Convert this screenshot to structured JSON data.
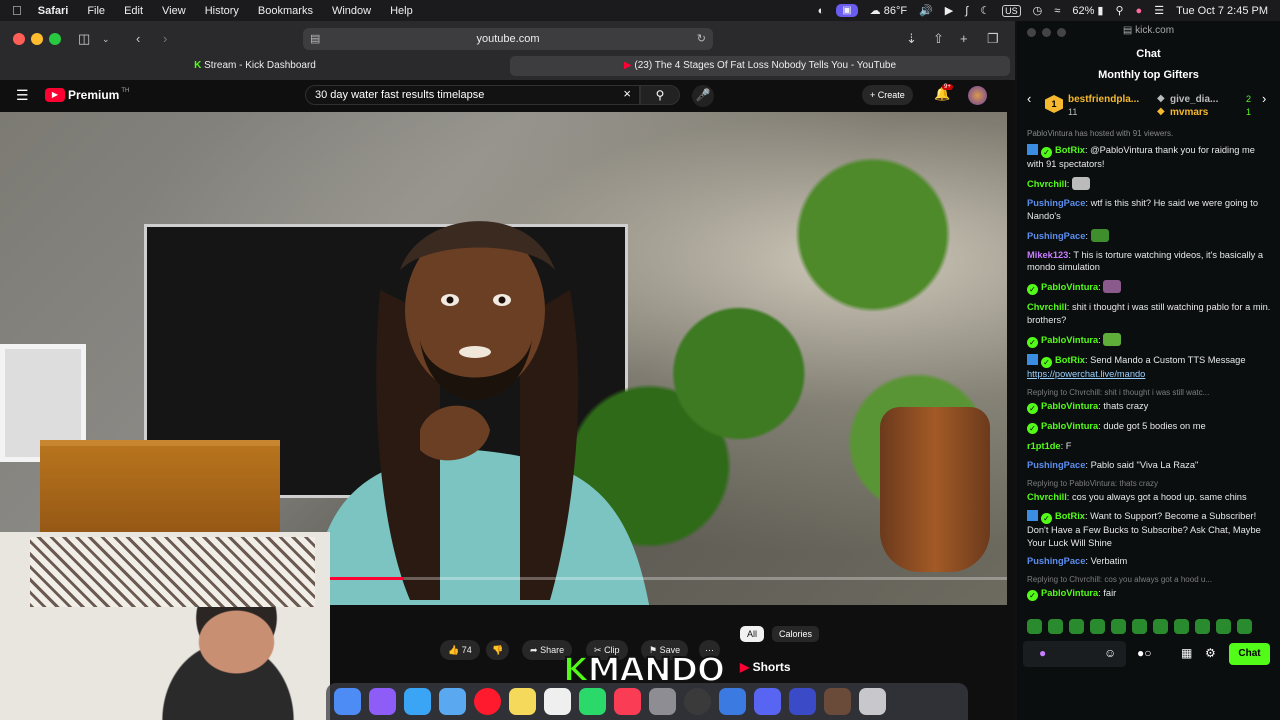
{
  "menubar": {
    "apple": "",
    "app": "Safari",
    "items": [
      "File",
      "Edit",
      "View",
      "History",
      "Bookmarks",
      "Window",
      "Help"
    ],
    "weather": "86°F",
    "flag": "US",
    "battery": "62%",
    "datetime": "Tue Oct 7  2:45 PM"
  },
  "safari": {
    "url": "youtube.com",
    "tabs": [
      {
        "label": "Stream - Kick Dashboard"
      },
      {
        "label": "(23) The 4 Stages Of Fat Loss Nobody Tells You - YouTube"
      }
    ]
  },
  "youtube": {
    "logo": "Premium",
    "logo_sup": "TH",
    "search_value": "30 day water fast results timelapse",
    "create_label": "Create",
    "notif_count": "9+",
    "progress": 0.11,
    "likes": "74",
    "share_label": "Share",
    "clip_label": "Clip",
    "save_label": "Save",
    "chips": [
      "All",
      "Calories"
    ],
    "shorts_label": "Shorts"
  },
  "overlay": {
    "k": "K",
    "text": "MANDO"
  },
  "kick": {
    "url": "kick.com",
    "chat_title": "Chat",
    "gifters_title": "Monthly top Gifters",
    "gifters": [
      {
        "rank": "1",
        "name": "bestfriendpla...",
        "count": "11"
      },
      {
        "rank": "",
        "name": "give_dia...",
        "count": "2"
      },
      {
        "rank": "",
        "name": "mvmars",
        "count": "1"
      }
    ],
    "host_notice": "PabloVintura has hosted with 91 viewers.",
    "messages": [
      {
        "user": "BotRix",
        "color": "#53fc18",
        "bot": true,
        "text": "@PabloVintura thank you for raiding me with 91 spectators!"
      },
      {
        "user": "Chvrchill",
        "color": "#53fc18",
        "text": "",
        "emote": "#bbbbbb"
      },
      {
        "user": "PushingPace",
        "color": "#5b8ef0",
        "text": "wtf is this shit? He said we were going to Nando's"
      },
      {
        "user": "PushingPace",
        "color": "#5b8ef0",
        "text": "",
        "emote": "#3e8e2e"
      },
      {
        "user": "Mikek123",
        "color": "#c77dff",
        "text": "T his is torture watching videos, it's basically a mondo simulation"
      },
      {
        "user": "PabloVintura",
        "color": "#53fc18",
        "verified": true,
        "text": "",
        "emote": "#8b5a8c"
      },
      {
        "user": "Chvrchill",
        "color": "#53fc18",
        "text": "shit i thought i was still watching pablo for a min. brothers?"
      },
      {
        "user": "PabloVintura",
        "color": "#53fc18",
        "verified": true,
        "text": "",
        "emote": "#5fae3a"
      },
      {
        "user": "BotRix",
        "color": "#53fc18",
        "bot": true,
        "text": "Send Mando a Custom TTS Message",
        "link": "https://powerchat.live/mando"
      },
      {
        "reply": "Replying to Chvrchill: shit i thought i was still watc...",
        "user": "PabloVintura",
        "color": "#53fc18",
        "verified": true,
        "text": "thats crazy"
      },
      {
        "user": "PabloVintura",
        "color": "#53fc18",
        "verified": true,
        "text": "dude got 5 bodies on me"
      },
      {
        "user": "r1pt1de",
        "color": "#53fc18",
        "text": "F"
      },
      {
        "user": "PushingPace",
        "color": "#5b8ef0",
        "text": "Pablo said \"Viva La Raza\""
      },
      {
        "reply": "Replying to PabloVintura: thats crazy",
        "user": "Chvrchill",
        "color": "#53fc18",
        "text": "cos you always got a hood up. same chins"
      },
      {
        "user": "BotRix",
        "color": "#53fc18",
        "bot": true,
        "text": "Want to Support? Become a Subscriber! Don't Have a Few Bucks to Subscribe? Ask Chat, Maybe Your Luck Will Shine"
      },
      {
        "user": "PushingPace",
        "color": "#5b8ef0",
        "text": "Verbatim"
      },
      {
        "reply": "Replying to Chvrchill: cos you always got a hood u...",
        "user": "PabloVintura",
        "color": "#53fc18",
        "verified": true,
        "text": "fair"
      }
    ],
    "chat_button": "Chat"
  }
}
